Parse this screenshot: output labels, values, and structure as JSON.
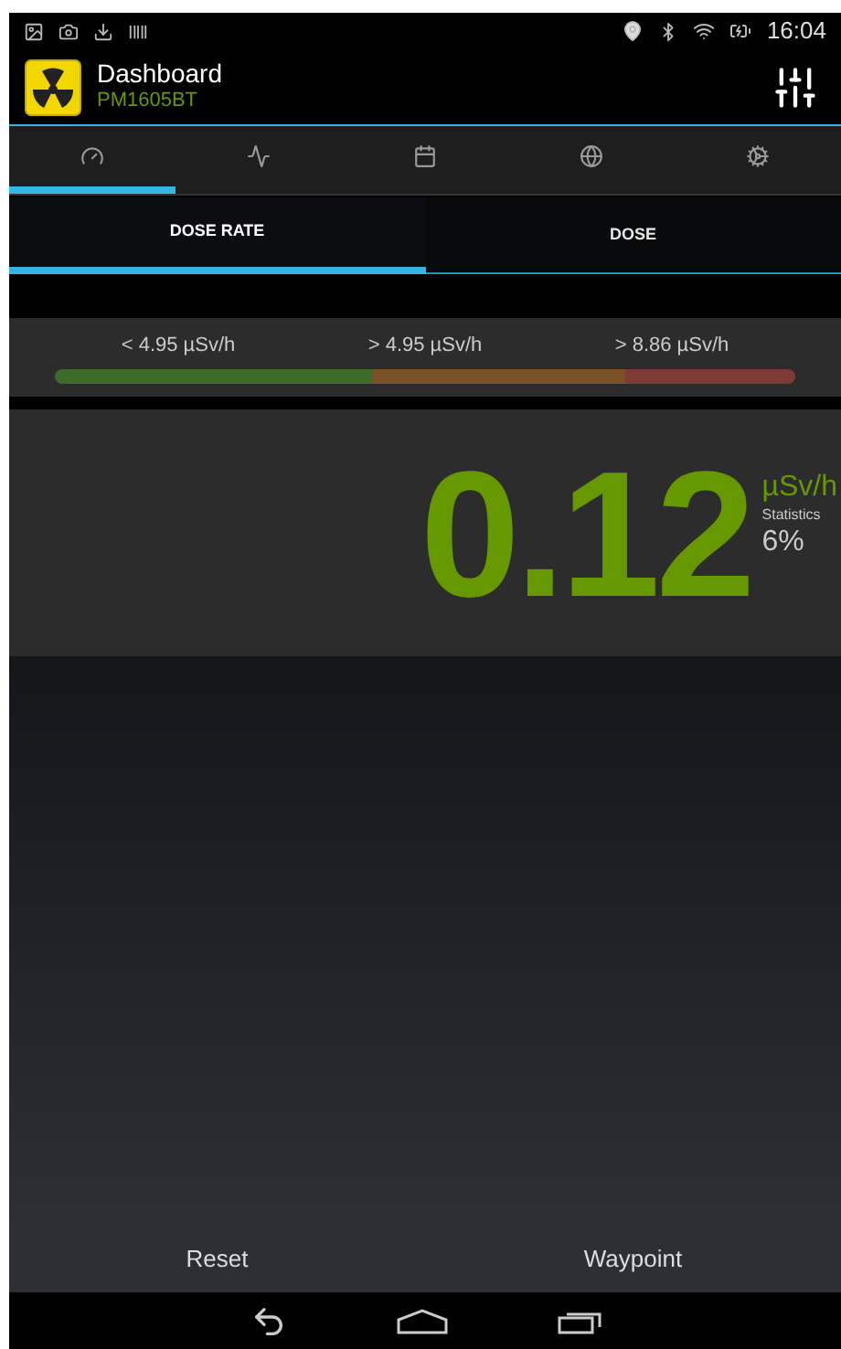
{
  "status_bar": {
    "time": "16:04"
  },
  "action_bar": {
    "title": "Dashboard",
    "subtitle": "PM1605BT"
  },
  "icon_tabs": [
    {
      "kind": "gauge",
      "selected": true
    },
    {
      "kind": "graph",
      "selected": false
    },
    {
      "kind": "calendar",
      "selected": false
    },
    {
      "kind": "globe",
      "selected": false
    },
    {
      "kind": "settings",
      "selected": false
    }
  ],
  "sub_tabs": [
    {
      "label": "DOSE RATE",
      "selected": true
    },
    {
      "label": "DOSE",
      "selected": false
    }
  ],
  "ranges": [
    {
      "label": "< 4.95 µSv/h",
      "color": "#3f6b2a"
    },
    {
      "label": "> 4.95 µSv/h",
      "color": "#7a5226"
    },
    {
      "label": "> 8.86 µSv/h",
      "color": "#7e3b36"
    }
  ],
  "reading": {
    "value": "0.12",
    "unit": "µSv/h",
    "statistics_label": "Statistics",
    "statistics_value": "6%"
  },
  "buttons": [
    "Reset",
    "Waypoint"
  ]
}
